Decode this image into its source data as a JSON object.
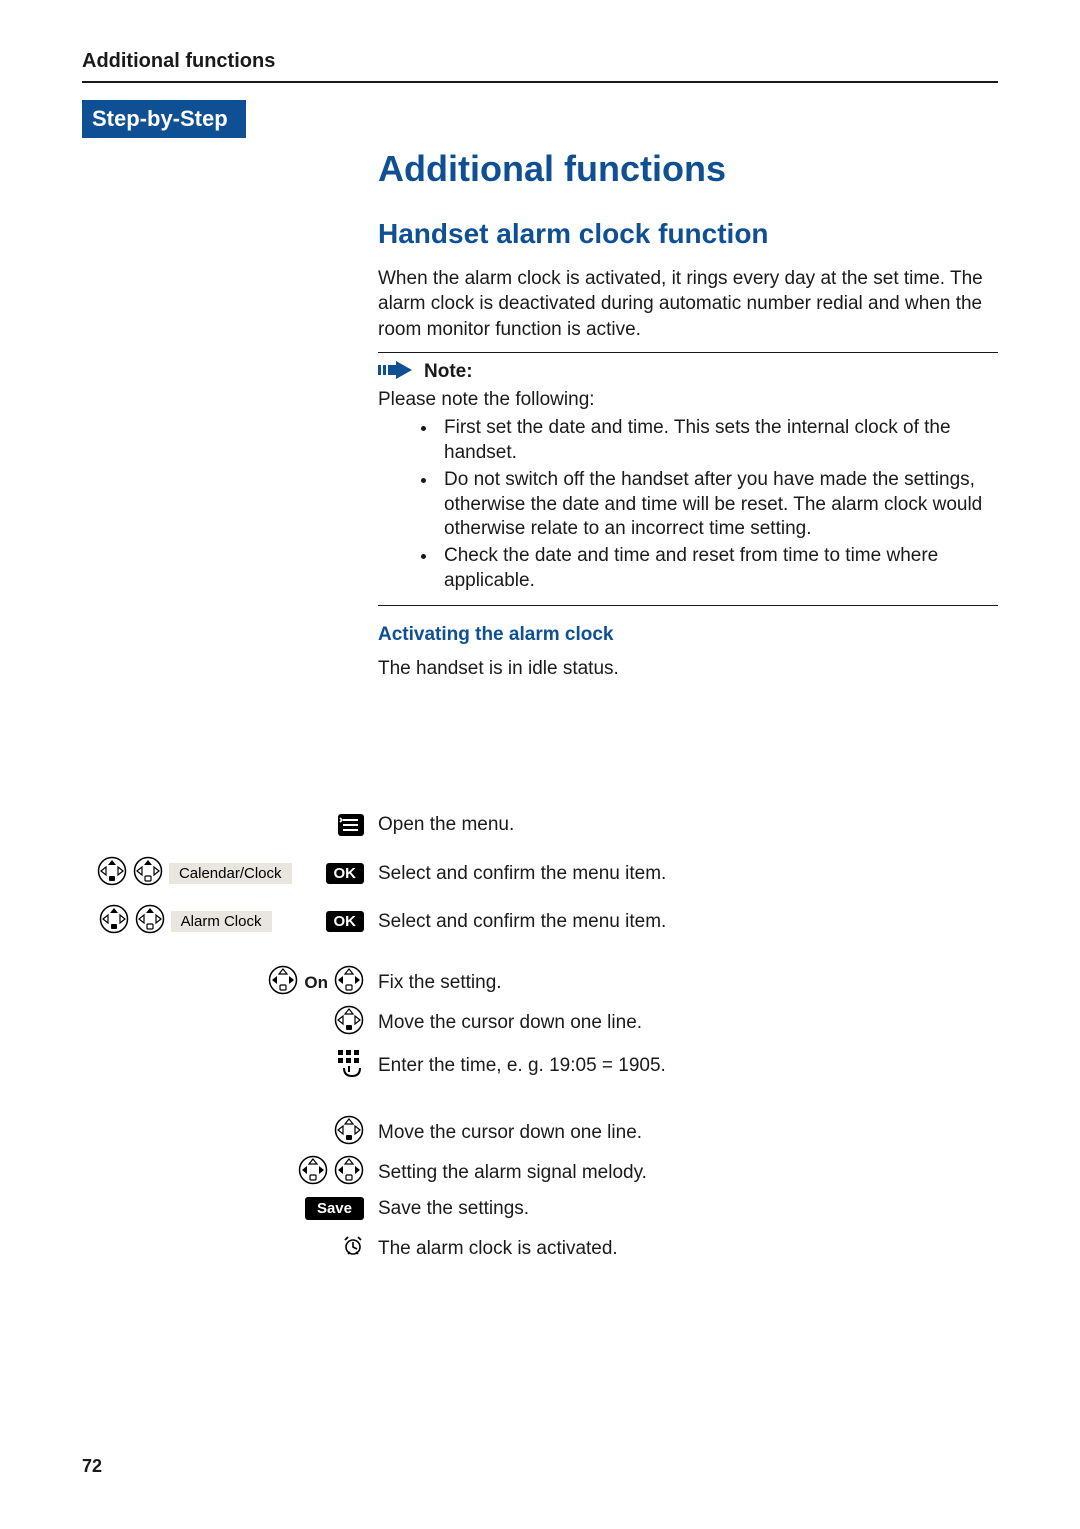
{
  "running_head": "Additional functions",
  "step_label": "Step-by-Step",
  "h1": "Additional functions",
  "h2": "Handset alarm clock function",
  "intro": "When the alarm clock is activated, it rings every day at the set time. The alarm clock is deactivated during automatic number redial and when the room monitor function is active.",
  "note": {
    "label": "Note:",
    "lead": "Please note the following:",
    "items": [
      "First set the date and time. This sets the internal clock of the handset.",
      "Do not switch off the handset after you have made the settings, otherwise the date and time will be reset. The alarm clock would otherwise relate to an incorrect time setting.",
      "Check the date and time and reset from time to time where applicable."
    ]
  },
  "h3": "Activating the alarm clock",
  "idle": "The handset is in idle status.",
  "steps": {
    "open_menu": "Open the menu.",
    "calendar_label": "Calendar/Clock",
    "calendar_desc": "Select and confirm the menu item.",
    "alarm_label": "Alarm Clock",
    "alarm_desc": "Select and confirm the menu item.",
    "on_label": "On",
    "fix": "Fix the setting.",
    "cursor1": "Move the cursor down one line.",
    "enter_time": "Enter the time, e. g. 19:05 = 1905.",
    "cursor2": "Move the cursor down one line.",
    "melody": "Setting the alarm signal melody.",
    "save_label": "Save",
    "save_desc": "Save the settings.",
    "activated": "The alarm clock is activated."
  },
  "ok_label": "OK",
  "page_number": "72"
}
